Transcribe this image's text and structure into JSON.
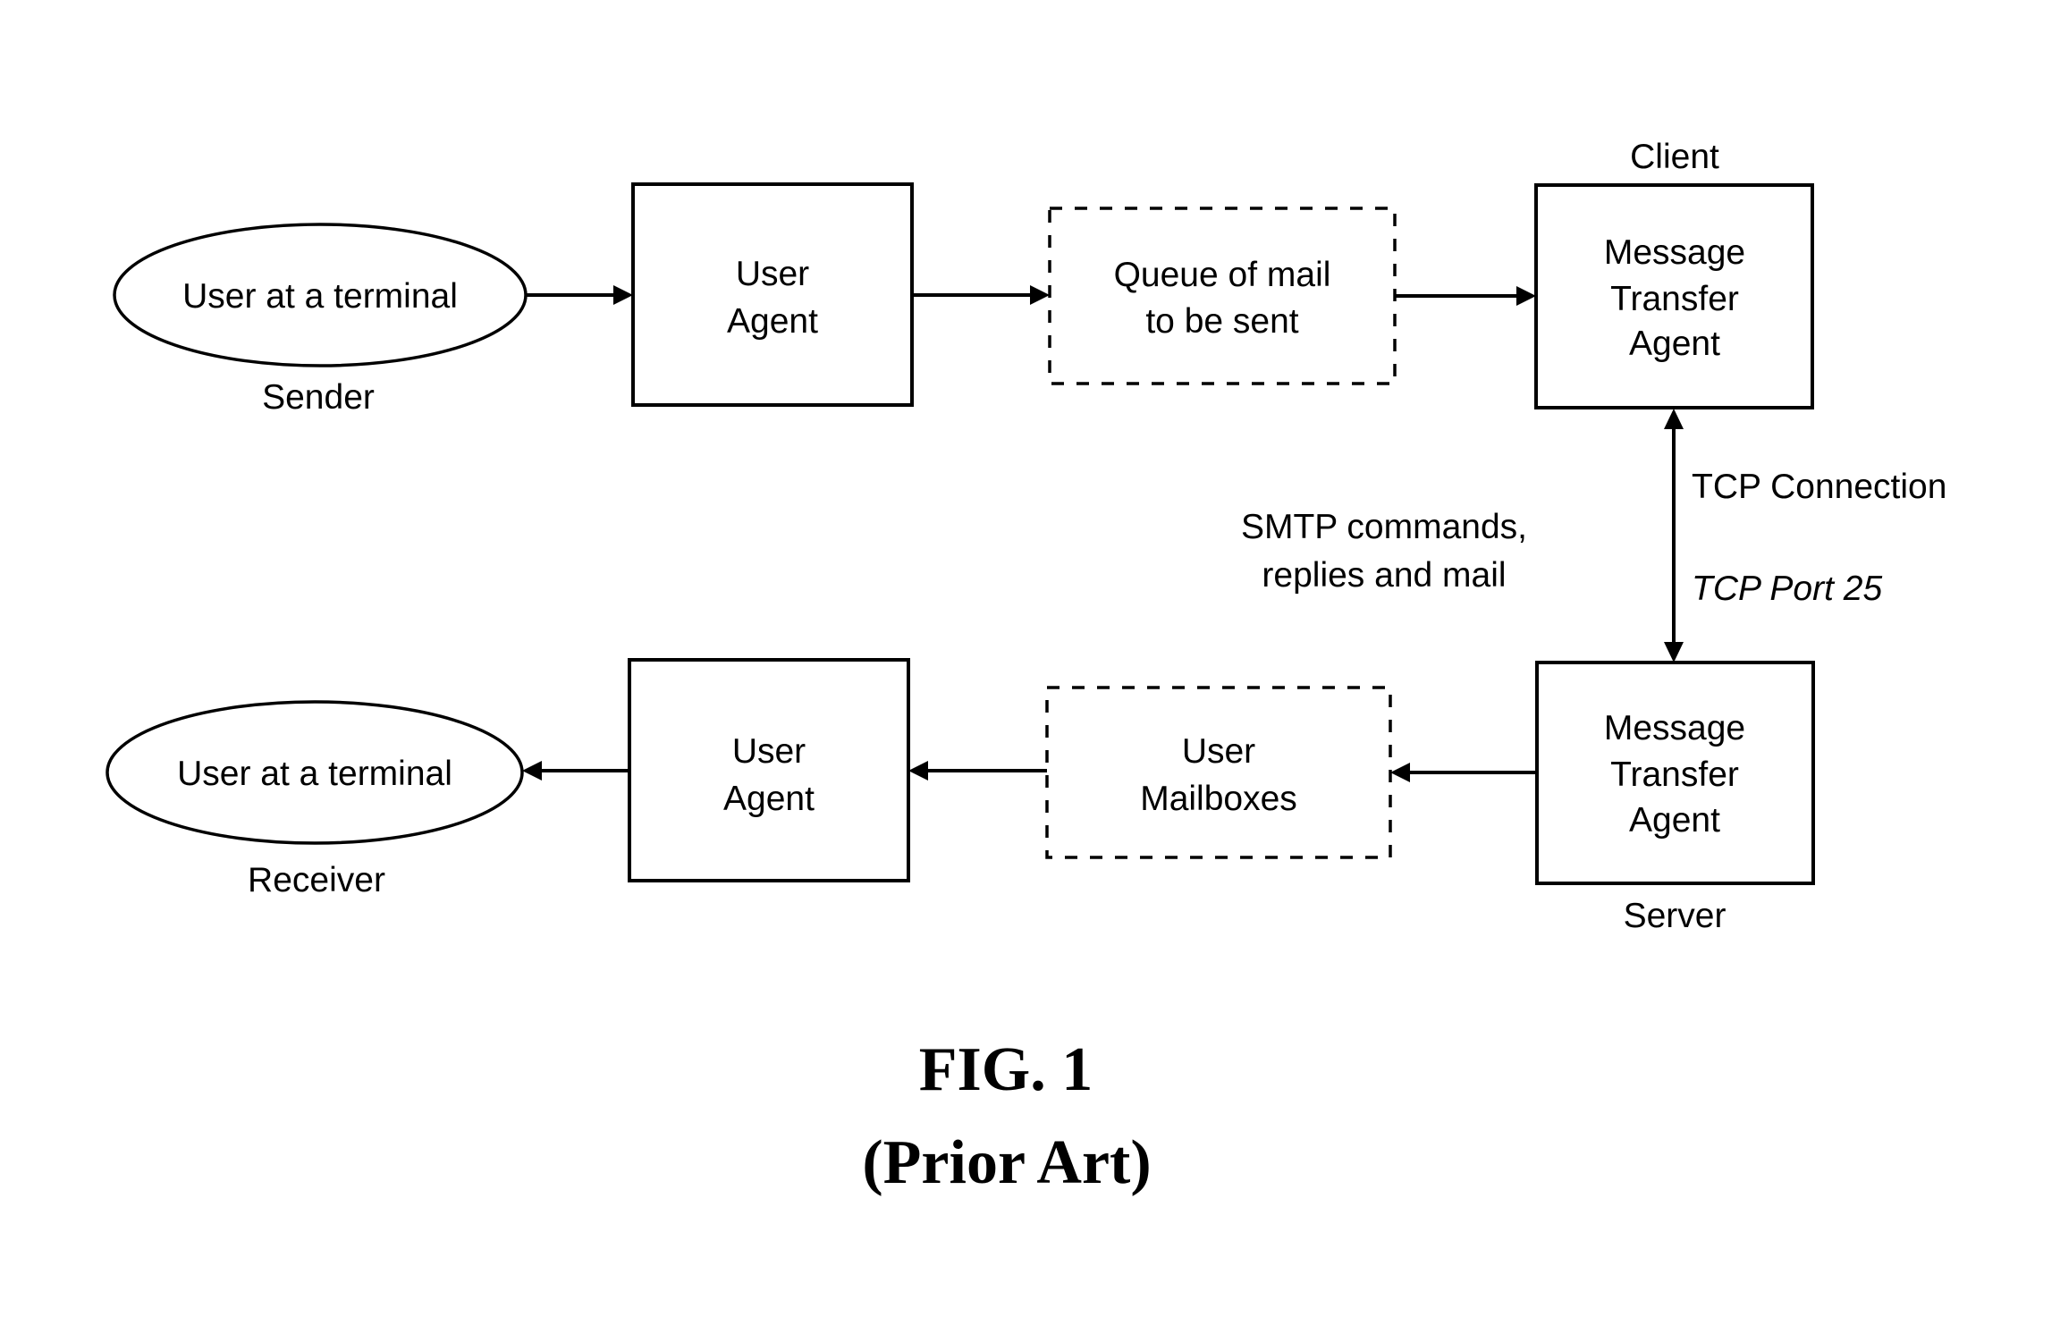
{
  "figure": {
    "caption": "FIG. 1",
    "subcaption": "(Prior Art)"
  },
  "sender": {
    "node_label": "User at a terminal",
    "role_label": "Sender",
    "user_agent_lines": [
      "User",
      "Agent"
    ],
    "queue_lines": [
      "Queue of mail",
      "to be sent"
    ],
    "mta_lines": [
      "Message",
      "Transfer",
      "Agent"
    ],
    "mta_role_label": "Client"
  },
  "receiver": {
    "node_label": "User at a terminal",
    "role_label": "Receiver",
    "user_agent_lines": [
      "User",
      "Agent"
    ],
    "mailbox_lines": [
      "User",
      "Mailboxes"
    ],
    "mta_lines": [
      "Message",
      "Transfer",
      "Agent"
    ],
    "mta_role_label": "Server"
  },
  "connection": {
    "label": "TCP Connection",
    "port_label": "TCP Port 25",
    "traffic_lines": [
      "SMTP commands,",
      "replies and mail"
    ]
  }
}
